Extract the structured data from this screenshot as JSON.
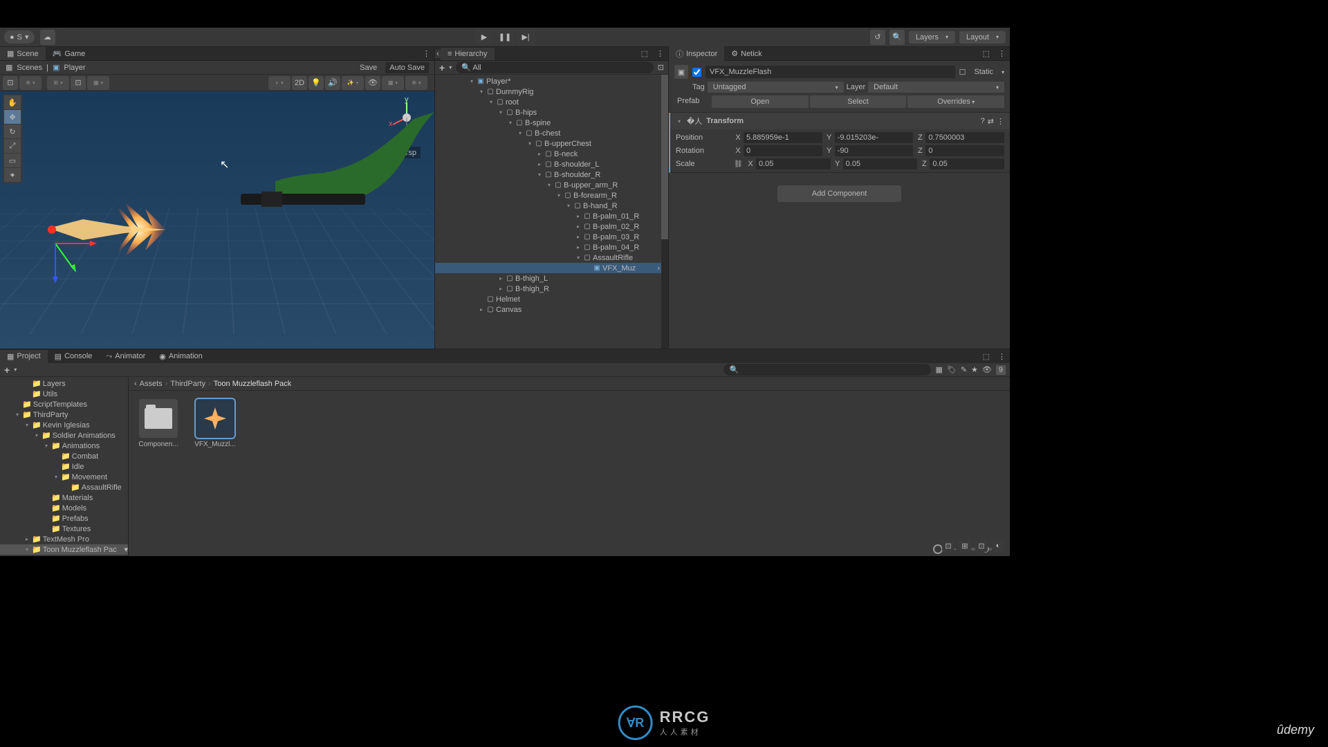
{
  "toolbar": {
    "account": "S",
    "layers": "Layers",
    "layout": "Layout"
  },
  "tabs": {
    "scene": "Scene",
    "game": "Game",
    "hierarchy": "Hierarchy",
    "inspector": "Inspector",
    "netick": "Netick",
    "project": "Project",
    "console": "Console",
    "animator": "Animator",
    "animation": "Animation"
  },
  "scene": {
    "breadcrumb_root": "Scenes",
    "breadcrumb_item": "Player",
    "save": "Save",
    "autosave": "Auto Save",
    "mode2d": "2D",
    "persp": "Persp"
  },
  "hierarchy": {
    "search": "All",
    "root": "Player*",
    "items": [
      "DummyRig",
      "root",
      "B-hips",
      "B-spine",
      "B-chest",
      "B-upperChest",
      "B-neck",
      "B-shoulder_L",
      "B-shoulder_R",
      "B-upper_arm_R",
      "B-forearm_R",
      "B-hand_R",
      "B-palm_01_R",
      "B-palm_02_R",
      "B-palm_03_R",
      "B-palm_04_R",
      "AssaultRifle",
      "VFX_Muz",
      "B-thigh_L",
      "B-thigh_R",
      "Helmet",
      "Canvas"
    ]
  },
  "inspector": {
    "name": "VFX_MuzzleFlash",
    "static": "Static",
    "tag_label": "Tag",
    "tag": "Untagged",
    "layer_label": "Layer",
    "layer": "Default",
    "prefab": "Prefab",
    "open": "Open",
    "select": "Select",
    "overrides": "Overrides",
    "transform": "Transform",
    "position": "Position",
    "rotation": "Rotation",
    "scale": "Scale",
    "pos": {
      "x": "5.885959e-1",
      "y": "-9.015203e-",
      "z": "0.7500003"
    },
    "rot": {
      "x": "0",
      "y": "-90",
      "z": "0"
    },
    "scl": {
      "x": "0.05",
      "y": "0.05",
      "z": "0.05"
    },
    "add": "Add Component"
  },
  "project": {
    "tree": [
      "Layers",
      "Utils",
      "ScriptTemplates",
      "ThirdParty",
      "Kevin Iglesias",
      "Soldier Animations",
      "Animations",
      "Combat",
      "Idle",
      "Movement",
      "AssaultRifle",
      "Materials",
      "Models",
      "Prefabs",
      "Textures",
      "TextMesh Pro",
      "Toon Muzzleflash Pac"
    ],
    "bc": [
      "Assets",
      "ThirdParty",
      "Toon Muzzleflash Pack"
    ],
    "assets": [
      "Componen...",
      "VFX_Muzzl..."
    ],
    "badge": "9"
  }
}
